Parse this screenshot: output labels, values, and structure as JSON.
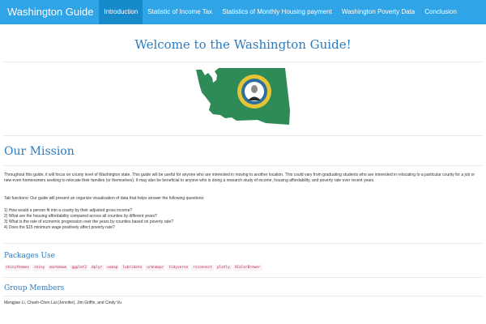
{
  "navbar": {
    "brand": "Washington Guide",
    "items": [
      {
        "label": "Introduction"
      },
      {
        "label": "Statistic of Income Tax"
      },
      {
        "label": "Statistics of Monthly Housing payment"
      },
      {
        "label": "Washington Poverty Data"
      },
      {
        "label": "Conclusion"
      }
    ],
    "active_index": 0
  },
  "main": {
    "title": "Welcome to the Washington Guide!",
    "map_image": {
      "icon": "washington-state-flag-map-icon",
      "color": "#2e8b57"
    },
    "mission": {
      "heading": "Our Mission",
      "paragraph1": "Throughout this guide, it will focus on county level of Washington state. This guide will be useful for anyone who are interested in moving to another location. This could vary from graduating students who are interested in relocating to a particular county for a job or new even homeowners seeking to relocate their families (or themselves). It may also be beneficial to anyone who is doing a research study of income, housing affordability, and poverty rate over recent years.",
      "paragraph2": "Tab functions: Our guide will present an organize visualization of data that helps answer the following questions:",
      "questions": [
        "1) How would a person fit into a county by their adjusted gross income?",
        "2) What are the housing affordability compared across all counties by different years?",
        "3) What is the rate of economic progression over the years by counties based on poverty rate?",
        "4) Does the $15 minimum wage positively affect poverty rate?"
      ]
    },
    "packages": {
      "heading": "Packages Use",
      "items": [
        "shinythemes",
        "shiny",
        "markdown",
        "ggplot2",
        "dplyr",
        "usmap",
        "lubridate",
        "urbnmapr",
        "tidyverse",
        "rsconnect",
        "plotly",
        "XColorBrewer"
      ]
    },
    "group": {
      "heading": "Group Members",
      "members": "Mengjiao Li, Chueh-Chen Lai (Jennifer), Jim Griffin, and Cindy Vu"
    }
  },
  "colors": {
    "navbar": "#2fa4e7",
    "navbar_active": "#178acc",
    "heading": "#2c7bbf",
    "code": "#c7254e"
  }
}
